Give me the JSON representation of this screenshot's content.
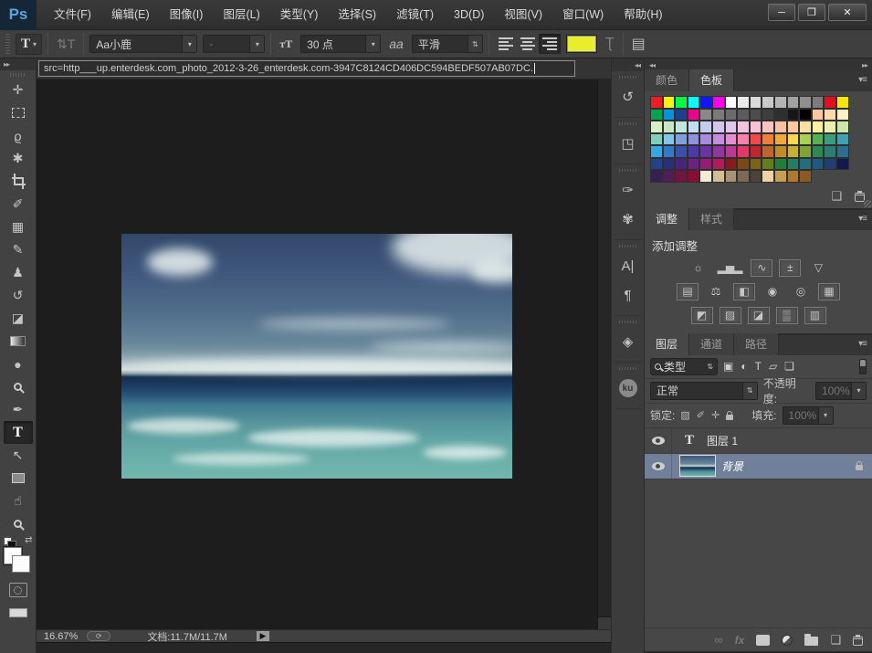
{
  "titlebar": {
    "logo": "Ps",
    "menus": [
      "文件(F)",
      "编辑(E)",
      "图像(I)",
      "图层(L)",
      "类型(Y)",
      "选择(S)",
      "滤镜(T)",
      "3D(D)",
      "视图(V)",
      "窗口(W)",
      "帮助(H)"
    ],
    "window_controls": {
      "minimize": "─",
      "maximize": "❐",
      "close": "✕"
    }
  },
  "options_bar": {
    "tool_letter": "T",
    "orientation_icon": "⇅T",
    "font_family": "Aa小鹿",
    "font_style": "-",
    "size_icon": "ᴛT",
    "font_size": "30 点",
    "aa_icon": "aa",
    "anti_alias": "平滑",
    "text_color": "#e8ef2a",
    "warp_icon": "Ʈ",
    "panels_icon": "▤"
  },
  "document_tab": {
    "title": "src=http___up.enterdesk.com_photo_2012-3-26_enterdesk.com-3947C8124CD406DC594BEDF507AB07DC."
  },
  "toolbar": {
    "expand": "▸▸",
    "tools": [
      {
        "name": "move-tool",
        "glyph": "✛"
      },
      {
        "name": "rectangular-marquee-tool",
        "css": "i-marquee"
      },
      {
        "name": "lasso-tool",
        "glyph": "ϱ"
      },
      {
        "name": "magic-wand-tool",
        "glyph": "✱"
      },
      {
        "name": "crop-tool",
        "css": "i-crop"
      },
      {
        "name": "eyedropper-tool",
        "glyph": "✐"
      },
      {
        "name": "healing-brush-tool",
        "glyph": "▦"
      },
      {
        "name": "brush-tool",
        "glyph": "✎"
      },
      {
        "name": "clone-stamp-tool",
        "glyph": "♟"
      },
      {
        "name": "history-brush-tool",
        "glyph": "↺"
      },
      {
        "name": "eraser-tool",
        "glyph": "◪"
      },
      {
        "name": "gradient-tool",
        "css": "i-gradient"
      },
      {
        "name": "blur-tool",
        "glyph": "●"
      },
      {
        "name": "dodge-tool",
        "css": "i-loupe"
      },
      {
        "name": "pen-tool",
        "glyph": "✒"
      },
      {
        "name": "type-tool",
        "glyph": "T",
        "serif": true,
        "selected": true
      },
      {
        "name": "path-selection-tool",
        "glyph": "↖"
      },
      {
        "name": "rectangle-tool",
        "css": "i-shape"
      },
      {
        "name": "hand-tool",
        "glyph": "☝"
      },
      {
        "name": "zoom-tool",
        "css": "i-loupe"
      }
    ]
  },
  "statusbar": {
    "zoom": "16.67%",
    "doc_info": "文档:11.7M/11.7M",
    "arrow": "▶"
  },
  "dock_strip": {
    "collapse": "◂◂",
    "groups": [
      [
        {
          "name": "history-panel-icon",
          "glyph": "↺"
        }
      ],
      [
        {
          "name": "properties-panel-icon",
          "glyph": "◳"
        }
      ],
      [
        {
          "name": "brush-panel-icon",
          "glyph": "✑"
        },
        {
          "name": "brush-presets-panel-icon",
          "glyph": "✾"
        }
      ],
      [
        {
          "name": "character-panel-icon",
          "glyph": "A|"
        },
        {
          "name": "paragraph-panel-icon",
          "glyph": "¶"
        }
      ],
      [
        {
          "name": "3d-panel-icon",
          "glyph": "◈"
        }
      ],
      [
        {
          "name": "kuler-panel-icon",
          "glyph": "ku",
          "circle": true
        }
      ]
    ],
    "expand": "▸▸"
  },
  "panels": {
    "collapse_left": "◂◂",
    "expand_right": "▸▸",
    "swatches": {
      "tabs": [
        {
          "label": "颜色",
          "active": false
        },
        {
          "label": "色板",
          "active": true
        }
      ],
      "menu_icon": "▾≡",
      "new_swatch_icon": "❏",
      "rows": [
        [
          "#ee1c25",
          "#fff200",
          "#00ff40",
          "#00ffff",
          "#1014ff",
          "#ff00ea",
          "#ffffff",
          "#ececec",
          "#dadada",
          "#c8c8c8",
          "#b5b5b5",
          "#a2a2a2",
          "#8f8f8f",
          "#7c7c7c",
          "#e01020",
          "#ffe60a"
        ],
        [
          "#00a551",
          "#0093dd",
          "#1c3f94",
          "#ec008c",
          "#898989",
          "#7a7a7a",
          "#6b6b6b",
          "#5c5c5c",
          "#4d4d4d",
          "#3e3e3e",
          "#2f2f2f",
          "#161616",
          "#000000",
          "#fbc8a2",
          "#fcd9ae",
          "#fdf1c5"
        ],
        [
          "#d9eec5",
          "#c6e8c0",
          "#c0e7da",
          "#c2dff2",
          "#c5cbee",
          "#d3c5ed",
          "#e3c5ee",
          "#f1c3e3",
          "#f7c1d3",
          "#fac3bd",
          "#fbbfa4",
          "#fcc9a0",
          "#fdde9d",
          "#fdf19e",
          "#e9f2ab",
          "#cde8a6"
        ],
        [
          "#7ed1b8",
          "#82c6ec",
          "#7ea0dc",
          "#8e92da",
          "#a88cdb",
          "#c68dde",
          "#e58dcf",
          "#f582ad",
          "#ee4a4a",
          "#f07e34",
          "#f2a83a",
          "#ffd849",
          "#a9d052",
          "#56b056",
          "#3a9d7d",
          "#3ea2b1"
        ],
        [
          "#34a9e1",
          "#3478c8",
          "#394ead",
          "#4a3aa5",
          "#6b34a3",
          "#9535a1",
          "#c13692",
          "#e43968",
          "#c0262c",
          "#c06429",
          "#c08b2b",
          "#c8b12d",
          "#7ea532",
          "#2b8951",
          "#2a7d71",
          "#2b6e8d"
        ],
        [
          "#27408b",
          "#2a2e7f",
          "#492380",
          "#6c2281",
          "#931e77",
          "#b21c5b",
          "#8e191d",
          "#7b4915",
          "#7b6319",
          "#637f1b",
          "#207e3c",
          "#207e62",
          "#206e7f",
          "#20597f",
          "#203e6f",
          "#0f1b4d"
        ],
        [
          "#391e54",
          "#531d56",
          "#701443",
          "#8d0c34",
          "#f3ebd3",
          "#d5bc93",
          "#aa9173",
          "#7c6957",
          "#4b433b",
          "#eed29f",
          "#c89e51",
          "#b0792b",
          "#8e5a20"
        ]
      ]
    },
    "adjustments": {
      "tabs": [
        {
          "label": "调整",
          "active": true
        },
        {
          "label": "样式",
          "active": false
        }
      ],
      "menu_icon": "▾≡",
      "label": "添加调整",
      "rows": [
        [
          {
            "name": "brightness-contrast-icon",
            "glyph": "☼",
            "boxed": false
          },
          {
            "name": "levels-icon",
            "glyph": "▂▅▂",
            "boxed": false
          },
          {
            "name": "curves-icon",
            "glyph": "∿",
            "boxed": true
          },
          {
            "name": "exposure-icon",
            "glyph": "±",
            "boxed": true
          },
          {
            "name": "vibrance-icon",
            "glyph": "▽",
            "boxed": false
          }
        ],
        [
          {
            "name": "hue-saturation-icon",
            "glyph": "▤",
            "boxed": true
          },
          {
            "name": "color-balance-icon",
            "glyph": "⚖",
            "boxed": false
          },
          {
            "name": "black-white-icon",
            "glyph": "◧",
            "boxed": true
          },
          {
            "name": "photo-filter-icon",
            "glyph": "◉",
            "boxed": false
          },
          {
            "name": "channel-mixer-icon",
            "glyph": "◎",
            "boxed": false
          },
          {
            "name": "color-lookup-icon",
            "glyph": "▦",
            "boxed": true
          }
        ],
        [
          {
            "name": "invert-icon",
            "glyph": "◩",
            "boxed": true
          },
          {
            "name": "posterize-icon",
            "glyph": "▨",
            "boxed": true
          },
          {
            "name": "threshold-icon",
            "glyph": "◪",
            "boxed": true
          },
          {
            "name": "gradient-map-icon",
            "glyph": "▒",
            "boxed": true
          },
          {
            "name": "selective-color-icon",
            "glyph": "▥",
            "boxed": true
          }
        ]
      ]
    },
    "layers": {
      "tabs": [
        {
          "label": "图层",
          "active": true
        },
        {
          "label": "通道",
          "active": false
        },
        {
          "label": "路径",
          "active": false
        }
      ],
      "menu_icon": "▾≡",
      "filter": {
        "kind_label": "类型",
        "icons": [
          {
            "name": "filter-pixel-layers-icon",
            "glyph": "▣"
          },
          {
            "name": "filter-adjustment-layers-icon",
            "glyph": "◐"
          },
          {
            "name": "filter-type-layers-icon",
            "glyph": "T"
          },
          {
            "name": "filter-shape-layers-icon",
            "glyph": "▱"
          },
          {
            "name": "filter-smart-objects-icon",
            "glyph": "❏"
          }
        ]
      },
      "blend_mode": "正常",
      "opacity_label": "不透明度:",
      "opacity_value": "100%",
      "lock_label": "锁定:",
      "lock_icons": [
        {
          "name": "lock-transparency-icon",
          "glyph": "▨"
        },
        {
          "name": "lock-paint-icon",
          "glyph": "✐"
        },
        {
          "name": "lock-position-icon",
          "glyph": "✛"
        },
        {
          "name": "lock-all-icon",
          "glyph": "",
          "css": "mini-lock"
        }
      ],
      "fill_label": "填充:",
      "fill_value": "100%",
      "layer_rows": [
        {
          "name": "图层 1",
          "type": "text"
        },
        {
          "name": "背景",
          "type": "background",
          "locked": true
        }
      ],
      "footer_icons": [
        {
          "name": "link-layers-icon",
          "glyph": "∞",
          "dim": true
        },
        {
          "name": "layer-style-icon",
          "glyph": "fx",
          "cls": "fx",
          "dim": true
        },
        {
          "name": "add-layer-mask-icon",
          "css": "i-mask"
        },
        {
          "name": "new-adjustment-layer-icon",
          "css": "i-halfc"
        },
        {
          "name": "new-group-icon",
          "css": "i-folder"
        },
        {
          "name": "new-layer-icon",
          "glyph": "❏"
        },
        {
          "name": "delete-layer-icon",
          "css": "i-trash"
        }
      ]
    }
  }
}
